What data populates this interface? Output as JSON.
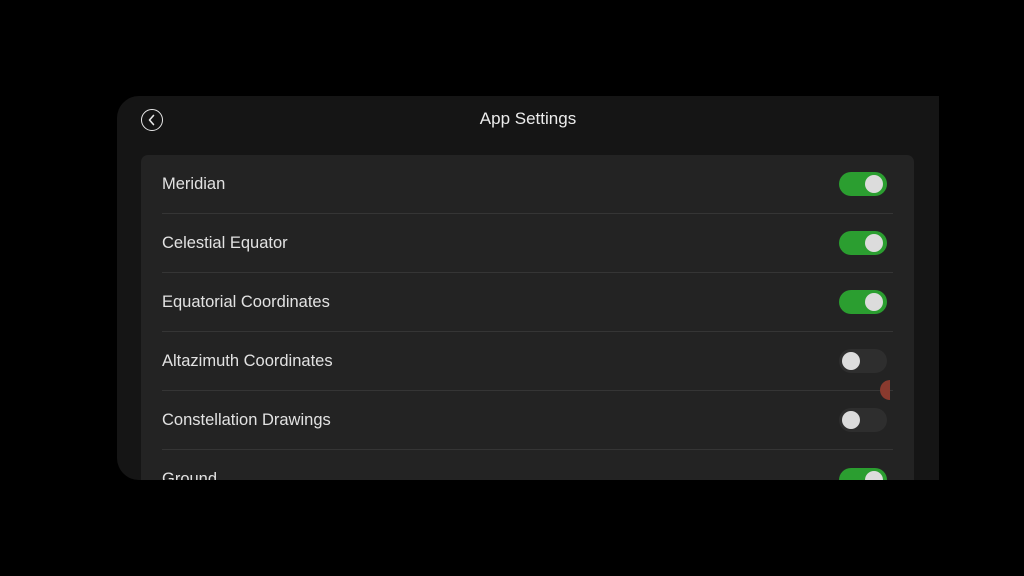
{
  "header": {
    "title": "App Settings",
    "back_icon": "chevron-left-circle-icon"
  },
  "settings": [
    {
      "label": "Meridian",
      "enabled": true
    },
    {
      "label": "Celestial Equator",
      "enabled": true
    },
    {
      "label": "Equatorial Coordinates",
      "enabled": true
    },
    {
      "label": "Altazimuth Coordinates",
      "enabled": false
    },
    {
      "label": "Constellation Drawings",
      "enabled": false
    },
    {
      "label": "Ground",
      "enabled": true
    }
  ],
  "colors": {
    "toggle_on": "#2b9e30",
    "toggle_off": "#2e2e2e",
    "panel_bg": "#151515",
    "card_bg": "#232323"
  }
}
